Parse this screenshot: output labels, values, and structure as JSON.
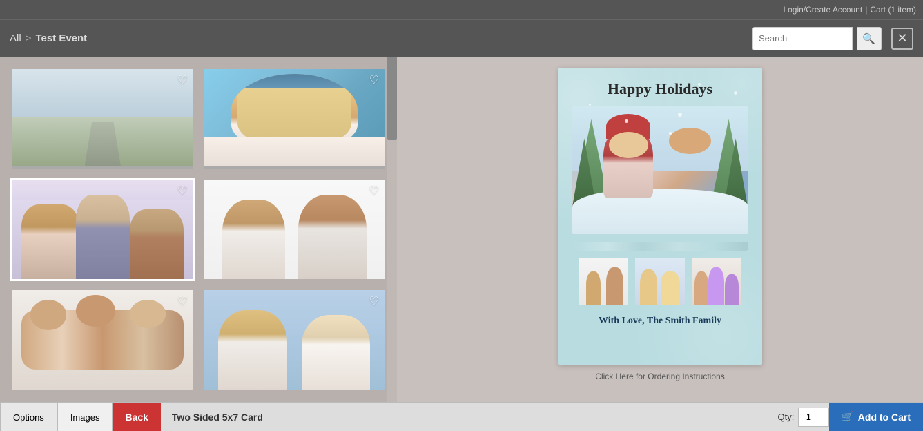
{
  "topbar": {
    "login_label": "Login/Create Account",
    "separator": "|",
    "cart_label": "Cart (1 item)"
  },
  "navbar": {
    "breadcrumb_all": "All",
    "breadcrumb_separator": ">",
    "breadcrumb_event": "Test Event",
    "search_placeholder": "Search",
    "search_button_icon": "🔍",
    "close_button_icon": "✕"
  },
  "tabs": {
    "options_label": "Options",
    "images_label": "Images"
  },
  "bottom_bar": {
    "back_label": "Back",
    "product_label": "Two Sided 5x7 Card",
    "qty_label": "Qty:",
    "qty_value": "1",
    "add_to_cart_label": "Add to Cart",
    "cart_icon": "🛒"
  },
  "card_preview": {
    "title": "Happy Holidays",
    "message": "With Love, The Smith Family",
    "ordering_link": "Click Here for Ordering Instructions"
  },
  "photos": [
    {
      "id": "photo-1",
      "type": "winter",
      "selected": false
    },
    {
      "id": "photo-2",
      "type": "woman",
      "selected": false
    },
    {
      "id": "photo-3",
      "type": "family1",
      "selected": true
    },
    {
      "id": "photo-4",
      "type": "couple",
      "selected": false
    },
    {
      "id": "photo-5",
      "type": "family2",
      "selected": false
    },
    {
      "id": "photo-6",
      "type": "elderly",
      "selected": false
    }
  ]
}
